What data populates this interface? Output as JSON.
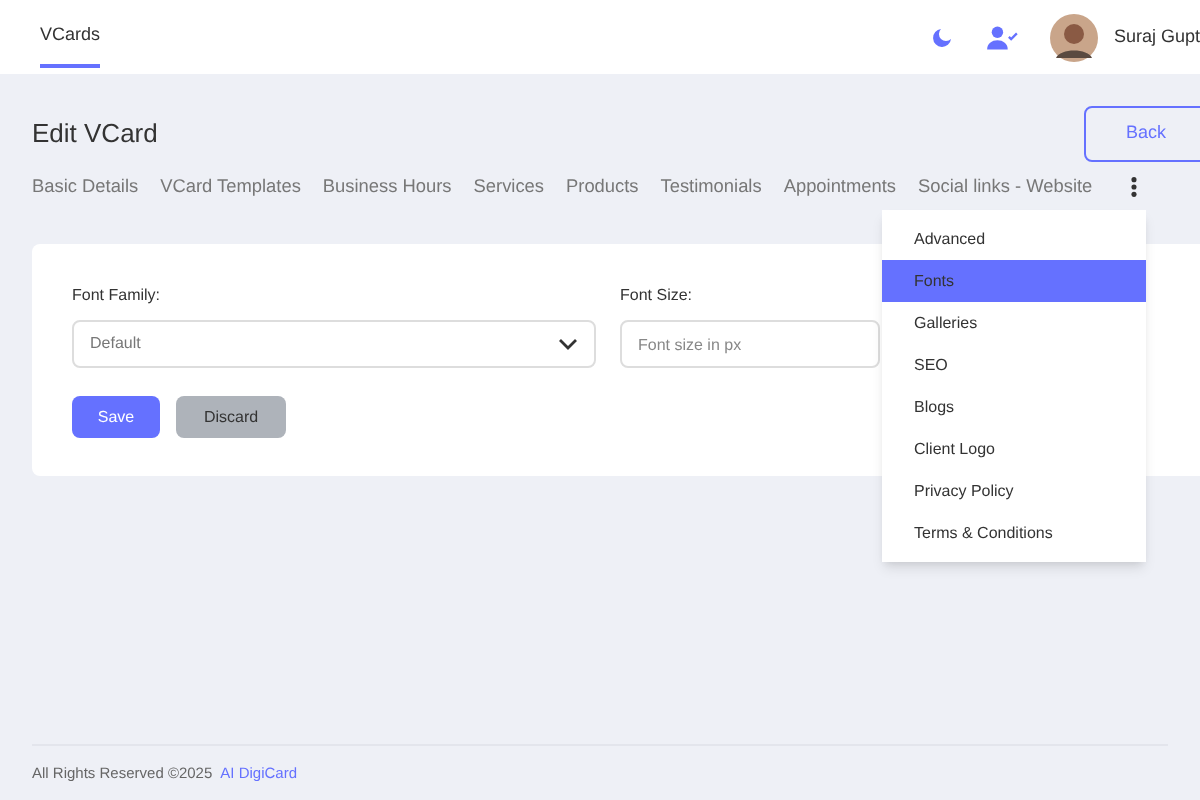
{
  "header": {
    "nav_tab": {
      "label": "VCards",
      "selected": true
    },
    "user_name": "Suraj Gupt"
  },
  "page": {
    "title": "Edit VCard",
    "back_button": "Back"
  },
  "tabs": [
    {
      "label": "Basic Details",
      "selected": false
    },
    {
      "label": "VCard Templates",
      "selected": false
    },
    {
      "label": "Business Hours",
      "selected": false
    },
    {
      "label": "Services",
      "selected": false
    },
    {
      "label": "Products",
      "selected": false
    },
    {
      "label": "Testimonials",
      "selected": false
    },
    {
      "label": "Appointments",
      "selected": false
    },
    {
      "label": "Social links - Website",
      "selected": false
    }
  ],
  "more_menu": [
    {
      "label": "Advanced",
      "selected": false
    },
    {
      "label": "Fonts",
      "selected": true
    },
    {
      "label": "Galleries",
      "selected": false
    },
    {
      "label": "SEO",
      "selected": false
    },
    {
      "label": "Blogs",
      "selected": false
    },
    {
      "label": "Client Logo",
      "selected": false
    },
    {
      "label": "Privacy Policy",
      "selected": false
    },
    {
      "label": "Terms & Conditions",
      "selected": false
    }
  ],
  "form": {
    "font_family": {
      "label": "Font Family:",
      "value": "Default"
    },
    "font_size": {
      "label": "Font Size:",
      "placeholder": "Font size in px"
    },
    "save": "Save",
    "discard": "Discard"
  },
  "footer": {
    "text": "All Rights Reserved ©2025",
    "link": "AI DigiCard"
  }
}
